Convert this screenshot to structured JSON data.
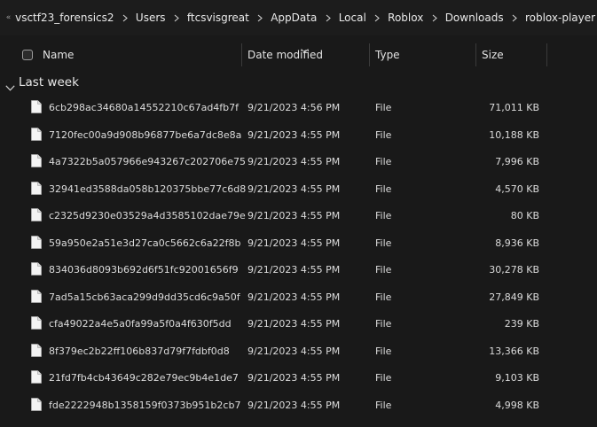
{
  "breadcrumb": {
    "items": [
      "vsctf23_forensics2",
      "Users",
      "ftcsvisgreat",
      "AppData",
      "Local",
      "Roblox",
      "Downloads",
      "roblox-player"
    ]
  },
  "columns": {
    "name": "Name",
    "date": "Date modified",
    "type": "Type",
    "size": "Size"
  },
  "group": {
    "label": "Last week"
  },
  "files": [
    {
      "name": "6cb298ac34680a14552210c67ad4fb7f",
      "date": "9/21/2023 4:56 PM",
      "type": "File",
      "size": "71,011 KB"
    },
    {
      "name": "7120fec00a9d908b96877be6a7dc8e8a",
      "date": "9/21/2023 4:55 PM",
      "type": "File",
      "size": "10,188 KB"
    },
    {
      "name": "4a7322b5a057966e943267c202706e75",
      "date": "9/21/2023 4:55 PM",
      "type": "File",
      "size": "7,996 KB"
    },
    {
      "name": "32941ed3588da058b120375bbe77c6d8",
      "date": "9/21/2023 4:55 PM",
      "type": "File",
      "size": "4,570 KB"
    },
    {
      "name": "c2325d9230e03529a4d3585102dae79e",
      "date": "9/21/2023 4:55 PM",
      "type": "File",
      "size": "80 KB"
    },
    {
      "name": "59a950e2a51e3d27ca0c5662c6a22f8b",
      "date": "9/21/2023 4:55 PM",
      "type": "File",
      "size": "8,936 KB"
    },
    {
      "name": "834036d8093b692d6f51fc92001656f9",
      "date": "9/21/2023 4:55 PM",
      "type": "File",
      "size": "30,278 KB"
    },
    {
      "name": "7ad5a15cb63aca299d9dd35cd6c9a50f",
      "date": "9/21/2023 4:55 PM",
      "type": "File",
      "size": "27,849 KB"
    },
    {
      "name": "cfa49022a4e5a0fa99a5f0a4f630f5dd",
      "date": "9/21/2023 4:55 PM",
      "type": "File",
      "size": "239 KB"
    },
    {
      "name": "8f379ec2b22ff106b837d79f7fdbf0d8",
      "date": "9/21/2023 4:55 PM",
      "type": "File",
      "size": "13,366 KB"
    },
    {
      "name": "21fd7fb4cb43649c282e79ec9b4e1de7",
      "date": "9/21/2023 4:55 PM",
      "type": "File",
      "size": "9,103 KB"
    },
    {
      "name": "fde2222948b1358159f0373b951b2cb7",
      "date": "9/21/2023 4:55 PM",
      "type": "File",
      "size": "4,998 KB"
    }
  ],
  "icons": {
    "breadcrumb_separator": "chevron-right-icon",
    "group_toggle": "chevron-down-icon",
    "sort_indicator": "chevron-down-icon",
    "file": "file-icon"
  }
}
